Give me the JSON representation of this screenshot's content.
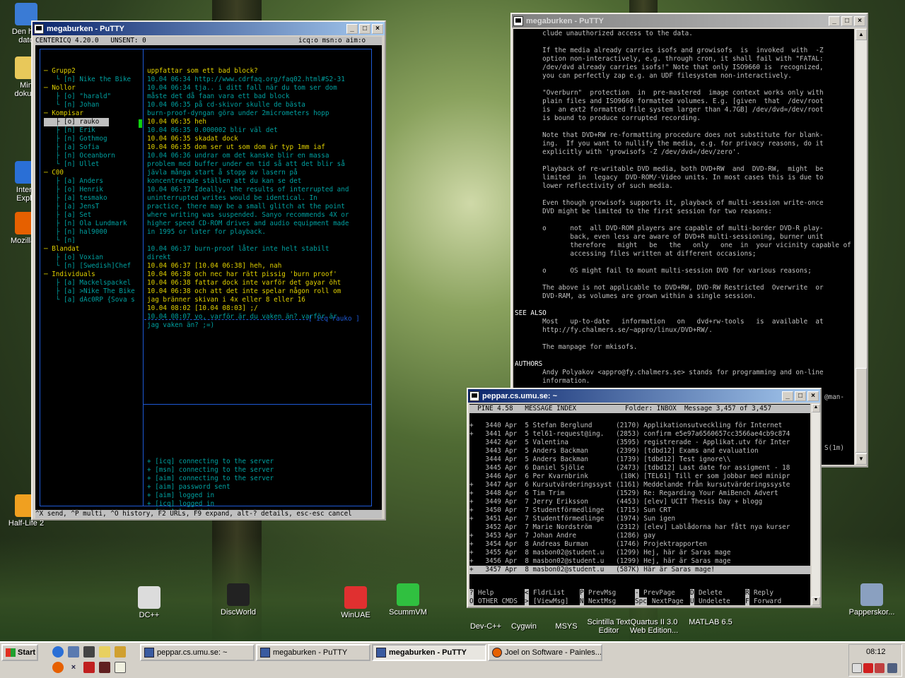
{
  "desktop": {
    "icons": [
      {
        "label": "Den h…\ndato",
        "icon": "computer-icon",
        "color": "#3a7bd5"
      },
      {
        "label": "Min\ndokum",
        "icon": "folder-icon",
        "color": "#e8c85a"
      },
      {
        "label": "Intern\nExplo",
        "icon": "ie-icon",
        "color": "#2a6fd6"
      },
      {
        "label": "Mozilla F",
        "icon": "firefox-icon",
        "color": "#e66000"
      },
      {
        "label": "Half-Life 2",
        "icon": "halflife-icon",
        "color": "#f0a020"
      },
      {
        "label": "DC++",
        "icon": "dc-icon",
        "color": "#dcdcdc"
      },
      {
        "label": "DiscWorld",
        "icon": "terminal-icon",
        "color": "#222"
      },
      {
        "label": "WinUAE",
        "icon": "winuae-icon",
        "color": "#e03030"
      },
      {
        "label": "ScummVM",
        "icon": "scummvm-icon",
        "color": "#30c040"
      },
      {
        "label": "Dev-C++",
        "icon": "devcpp-icon",
        "color": "#555"
      },
      {
        "label": "Cygwin",
        "icon": "cygwin-icon",
        "color": "#555"
      },
      {
        "label": "MSYS",
        "icon": "msys-icon",
        "color": "#555"
      },
      {
        "label": "Scintilla Text\nEditor",
        "icon": "scite-icon",
        "color": "#555"
      },
      {
        "label": "Quartus II 3.0\nWeb Edition...",
        "icon": "quartus-icon",
        "color": "#555"
      },
      {
        "label": "MATLAB 6.5",
        "icon": "matlab-icon",
        "color": "#555"
      },
      {
        "label": "Papperskor...",
        "icon": "recycle-bin-icon",
        "color": "#8aa0c0"
      }
    ]
  },
  "putty1": {
    "title": "megaburken - PuTTY",
    "status_left": "CENTERICQ 4.20.0   UNSENT: 0",
    "status_right": "icq:o msn:o aim:o",
    "contacts": [
      {
        "t": "─ Grupp2",
        "c": "#e0d000"
      },
      {
        "t": "   └ [n] Nike the Bike",
        "c": "#00a0a0"
      },
      {
        "t": "─ Nollor",
        "c": "#e0d000"
      },
      {
        "t": "   ├ [o] \"harald\"",
        "c": "#00a0a0"
      },
      {
        "t": "   └ [n] Johan",
        "c": "#00a0a0"
      },
      {
        "t": "─ Kompisar",
        "c": "#e0d000"
      },
      {
        "t": "   ├ [o] rauko",
        "c": "#000",
        "sel": true
      },
      {
        "t": "   ├ [n] Erik",
        "c": "#00a0a0"
      },
      {
        "t": "   ├ [n] Gothmog",
        "c": "#00a0a0"
      },
      {
        "t": "   ├ [a] Sofia",
        "c": "#00a0a0"
      },
      {
        "t": "   ├ [n] Oceanborn",
        "c": "#00a0a0"
      },
      {
        "t": "   └ [n] Ullet",
        "c": "#00a0a0"
      },
      {
        "t": "─ C00",
        "c": "#e0d000"
      },
      {
        "t": "   ├ [a] Anders",
        "c": "#00a0a0"
      },
      {
        "t": "   ├ [o] Henrik",
        "c": "#00a0a0"
      },
      {
        "t": "   ├ [a] tesmako",
        "c": "#00a0a0"
      },
      {
        "t": "   ├ [a] JensT",
        "c": "#00a0a0"
      },
      {
        "t": "   ├ [a] Set",
        "c": "#00a0a0"
      },
      {
        "t": "   ├ [n] Ola Lundmark",
        "c": "#00a0a0"
      },
      {
        "t": "   ├ [n] hal9000",
        "c": "#00a0a0"
      },
      {
        "t": "   └ [n]",
        "c": "#00a0a0"
      },
      {
        "t": "─ Blandat",
        "c": "#e0d000"
      },
      {
        "t": "   ├ [o] Voxian",
        "c": "#00a0a0"
      },
      {
        "t": "   └ [n] [Swedish]Chef",
        "c": "#00a0a0"
      },
      {
        "t": "─ Individuals",
        "c": "#e0d000"
      },
      {
        "t": "   ├ [a] Mackelspackel",
        "c": "#00a0a0"
      },
      {
        "t": "   ├ [a] >Nike The Bike",
        "c": "#00a0a0"
      },
      {
        "t": "   └ [a] dAc0RP {Sova s",
        "c": "#00a0a0"
      }
    ],
    "chat": [
      {
        "t": "uppfattar som ett bad block?",
        "c": "#e0d000"
      },
      {
        "t": "10.04 06:34 http://www.cdrfaq.org/faq02.html#S2-31",
        "c": "#00a0a0"
      },
      {
        "t": "10.04 06:34 tja.. i ditt fall när du tom ser dom",
        "c": "#00a0a0"
      },
      {
        "t": "måste det då faan vara ett bad block",
        "c": "#00a0a0"
      },
      {
        "t": "10.04 06:35 på cd-skivor skulle de bästa",
        "c": "#00a0a0"
      },
      {
        "t": "burn-proof-dyngan göra under 2micrometers hopp",
        "c": "#00a0a0"
      },
      {
        "t": "10.04 06:35 heh",
        "c": "#e0d000"
      },
      {
        "t": "10.04 06:35 0.000002 blir väl det",
        "c": "#00a0a0"
      },
      {
        "t": "10.04 06:35 skadat dock",
        "c": "#e0d000"
      },
      {
        "t": "10.04 06:35 dom ser ut som dom är typ 1mm iaf",
        "c": "#e0d000"
      },
      {
        "t": "10.04 06:36 undrar om det kanske blir en massa",
        "c": "#00a0a0"
      },
      {
        "t": "problem med buffer under en tid så att det blir så",
        "c": "#00a0a0"
      },
      {
        "t": "jävla många start å stopp av lasern på",
        "c": "#00a0a0"
      },
      {
        "t": "koncentrerade ställen att du kan se det",
        "c": "#00a0a0"
      },
      {
        "t": "10.04 06:37 Ideally, the results of interrupted and",
        "c": "#00a0a0"
      },
      {
        "t": "uninterrupted writes would be identical. In",
        "c": "#00a0a0"
      },
      {
        "t": "practice, there may be a small glitch at the point",
        "c": "#00a0a0"
      },
      {
        "t": "where writing was suspended. Sanyo recommends 4X or",
        "c": "#00a0a0"
      },
      {
        "t": "higher speed CD-ROM drives and audio equipment made",
        "c": "#00a0a0"
      },
      {
        "t": "in 1995 or later for playback.",
        "c": "#00a0a0"
      },
      {
        "t": "",
        "c": "#00a0a0"
      },
      {
        "t": "10.04 06:37 burn-proof låter inte helt stabilt",
        "c": "#00a0a0"
      },
      {
        "t": "direkt",
        "c": "#00a0a0"
      },
      {
        "t": "10.04 06:37 [10.04 06:38] heh, nah",
        "c": "#e0d000"
      },
      {
        "t": "10.04 06:38 och nec har rätt pissig 'burn proof'",
        "c": "#e0d000"
      },
      {
        "t": "10.04 06:38 fattar dock inte varför det gayar öht",
        "c": "#e0d000"
      },
      {
        "t": "10.04 06:38 och att det inte spelar någon roll om",
        "c": "#e0d000"
      },
      {
        "t": "jag bränner skivan i 4x eller 8 eller 16",
        "c": "#e0d000"
      },
      {
        "t": "10.04 08:02 [10.04 08:03] ;/",
        "c": "#e0d000"
      },
      {
        "t": "10.04 08:07 yo, varför är du vaken än? varför är",
        "c": "#00a0a0"
      },
      {
        "t": "jag vaken än? ;=)",
        "c": "#00a0a0"
      }
    ],
    "chat_footer": "[ icq rauko ]",
    "log": [
      "+ [icq] connecting to the server",
      "+ [msn] connecting to the server",
      "+ [aim] connecting to the server",
      "+ [aim] password sent",
      "+ [aim] logged in",
      "+ [icq] logged in",
      "+ [msn] logged in"
    ],
    "help": "^X send, ^P multi, ^O history, F2 URLs, F9 expand, alt-? details, esc-esc cancel"
  },
  "putty2": {
    "title": "megaburken - PuTTY",
    "lines": [
      {
        "t": "       clude unauthorized access to the data.",
        "c": "#c0c0c0"
      },
      {
        "t": "",
        "c": "#c0c0c0"
      },
      {
        "t": "       If the media already carries isofs and growisofs  is  invoked  with  -Z",
        "c": "#c0c0c0"
      },
      {
        "t": "       option non-interactively, e.g. through cron, it shall fail with \"FATAL:",
        "c": "#c0c0c0"
      },
      {
        "t": "       /dev/dvd already carries isofs!\" Note that only ISO9660 is  recognized,",
        "c": "#c0c0c0"
      },
      {
        "t": "       you can perfectly zap e.g. an UDF filesystem non-interactively.",
        "c": "#c0c0c0"
      },
      {
        "t": "",
        "c": "#c0c0c0"
      },
      {
        "t": "       \"Overburn\"  protection  in  pre-mastered  image context works only with",
        "c": "#c0c0c0"
      },
      {
        "t": "       plain files and ISO9660 formatted volumes. E.g. [given  that  /dev/root",
        "c": "#c0c0c0"
      },
      {
        "t": "       is  an ext2 formatted file system larger than 4.7GB] /dev/dvd=/dev/root",
        "c": "#c0c0c0"
      },
      {
        "t": "       is bound to produce corrupted recording.",
        "c": "#c0c0c0"
      },
      {
        "t": "",
        "c": "#c0c0c0"
      },
      {
        "t": "       Note that DVD+RW re-formatting procedure does not substitute for blank-",
        "c": "#c0c0c0"
      },
      {
        "t": "       ing.  If you want to nullify the media, e.g. for privacy reasons, do it",
        "c": "#c0c0c0"
      },
      {
        "t": "       explicitly with 'growisofs -Z /dev/dvd=/dev/zero'.",
        "c": "#c0c0c0"
      },
      {
        "t": "",
        "c": "#c0c0c0"
      },
      {
        "t": "       Playback of re-writable DVD media, both DVD+RW  and  DVD-RW,  might  be",
        "c": "#c0c0c0"
      },
      {
        "t": "       limited  in  legacy  DVD-ROM/-Video units. In most cases this is due to",
        "c": "#c0c0c0"
      },
      {
        "t": "       lower reflectivity of such media.",
        "c": "#c0c0c0"
      },
      {
        "t": "",
        "c": "#c0c0c0"
      },
      {
        "t": "       Even though growisofs supports it, playback of multi-session write-once",
        "c": "#c0c0c0"
      },
      {
        "t": "       DVD might be limited to the first session for two reasons:",
        "c": "#c0c0c0"
      },
      {
        "t": "",
        "c": "#c0c0c0"
      },
      {
        "t": "       o      not  all DVD-ROM players are capable of multi-border DVD-R play-",
        "c": "#c0c0c0"
      },
      {
        "t": "              back, even less are aware of DVD+R multi-sessioning, burner unit",
        "c": "#c0c0c0"
      },
      {
        "t": "              therefore   might   be   the   only   one  in  your vicinity capable of",
        "c": "#c0c0c0"
      },
      {
        "t": "              accessing files written at different occasions;",
        "c": "#c0c0c0"
      },
      {
        "t": "",
        "c": "#c0c0c0"
      },
      {
        "t": "       o      OS might fail to mount multi-session DVD for various reasons;",
        "c": "#c0c0c0"
      },
      {
        "t": "",
        "c": "#c0c0c0"
      },
      {
        "t": "       The above is not applicable to DVD+RW, DVD-RW Restricted  Overwrite  or",
        "c": "#c0c0c0"
      },
      {
        "t": "       DVD-RAM, as volumes are grown within a single session.",
        "c": "#c0c0c0"
      },
      {
        "t": "",
        "c": "#c0c0c0"
      },
      {
        "t": "SEE ALSO",
        "c": "#ffffff"
      },
      {
        "t": "       Most   up-to-date   information   on   dvd+rw-tools   is  available  at",
        "c": "#c0c0c0"
      },
      {
        "t": "       http://fy.chalmers.se/~appro/linux/DVD+RW/.",
        "c": "#c0c0c0"
      },
      {
        "t": "",
        "c": "#c0c0c0"
      },
      {
        "t": "       The manpage for mkisofs.",
        "c": "#c0c0c0"
      },
      {
        "t": "",
        "c": "#c0c0c0"
      },
      {
        "t": "AUTHORS",
        "c": "#ffffff"
      },
      {
        "t": "       Andy Polyakov <appro@fy.chalmers.se> stands for programming and on-line",
        "c": "#c0c0c0"
      },
      {
        "t": "       information.",
        "c": "#c0c0c0"
      }
    ],
    "peek1": "@man-",
    "peek2": "S(1m)"
  },
  "pine": {
    "title": "peppar.cs.umu.se: ~",
    "header_left": "  PINE 4.58   MESSAGE INDEX",
    "header_right": "Folder: INBOX  Message 3,457 of 3,457  ",
    "rows": [
      "+   3440 Apr  5 Stefan Berglund      (2170) Applikationsutveckling för Internet",
      "+   3441 Apr  5 tel61-request@ing.   (2853) confirm e5e97a6560657cc3566ae4cb9c874",
      "    3442 Apr  5 Valentina            (3595) registrerade - Applikat.utv för Inter",
      "    3443 Apr  5 Anders Backman       (2399) [tdbd12] Exams and evaluation",
      "    3444 Apr  5 Anders Backman       (1739) [tdbd12] Test ignore\\\\",
      "    3445 Apr  6 Daniel Sjölie        (2473) [tdbd12] Last date for assigment - 18",
      "    3446 Apr  6 Per Kvarnbrink        (10K) [TEL61] Till er som jobbar med minipr",
      "+   3447 Apr  6 Kursutvärderingssyst (1161) Meddelande från kursutvärderingssyste",
      "+   3448 Apr  6 Tim Trim             (1529) Re: Regarding Your AmiBench Advert",
      "+   3449 Apr  7 Jerry Eriksson       (4453) [elev] UCIT Thesis Day + blogg",
      "+   3450 Apr  7 Studentförmedlinge   (1715) Sun CRT",
      "+   3451 Apr  7 Studentförmedlinge   (1974) Sun igen",
      "    3452 Apr  7 Marie Nordström      (2312) [elev] Lablådorna har fått nya kurser",
      "+   3453 Apr  7 Johan Andre          (1286) gay",
      "+   3454 Apr  8 Andreas Burman       (1746) Projektrapporten",
      "+   3455 Apr  8 masbon02@student.u   (1299) Hej, här är Saras mage",
      "+   3456 Apr  8 masbon02@student.u   (1299) Hej, här är Saras mage",
      "+   3457 Apr  8 masbon02@student.u   (587K) Här är Saras mage!"
    ],
    "keys": [
      {
        "k": "?",
        "l": "Help",
        "k2": "O",
        "l2": "OTHER CMDS"
      },
      {
        "k": "<",
        "l": "FldrList",
        "k2": ">",
        "l2": "[ViewMsg]"
      },
      {
        "k": "P",
        "l": "PrevMsg",
        "k2": "N",
        "l2": "NextMsg"
      },
      {
        "k": "-",
        "l": "PrevPage",
        "k2": "Spc",
        "l2": "NextPage"
      },
      {
        "k": "D",
        "l": "Delete",
        "k2": "U",
        "l2": "Undelete"
      },
      {
        "k": "R",
        "l": "Reply",
        "k2": "F",
        "l2": "Forward"
      }
    ]
  },
  "taskbar": {
    "start": "Start",
    "tasks": [
      "peppar.cs.umu.se: ~",
      "megaburken - PuTTY",
      "megaburken - PuTTY",
      "Joel on Software - Painles..."
    ],
    "clock": "08:12"
  }
}
